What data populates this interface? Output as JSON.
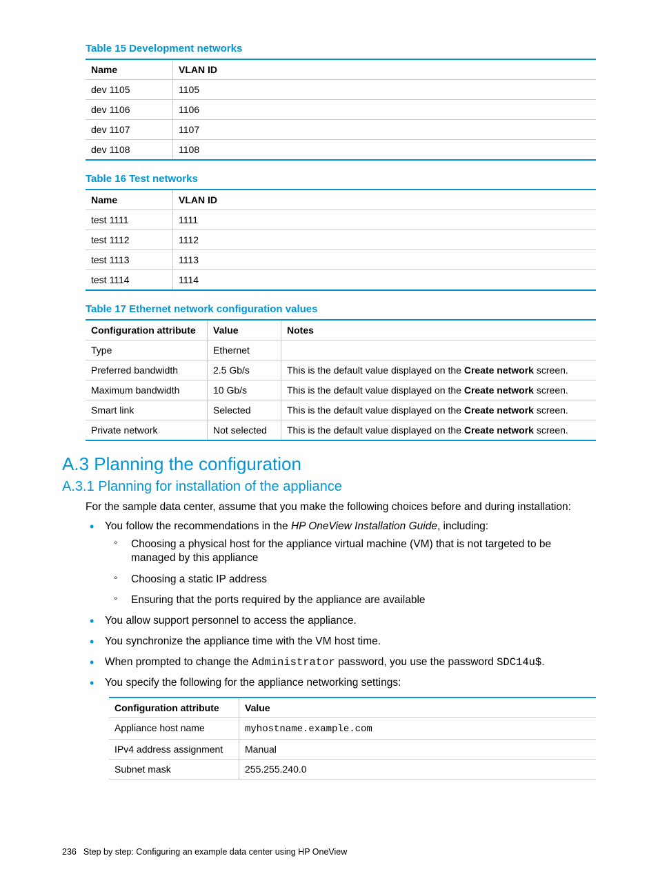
{
  "tables": {
    "t15": {
      "caption": "Table 15 Development networks",
      "headers": [
        "Name",
        "VLAN ID"
      ],
      "rows": [
        [
          "dev 1105",
          "1105"
        ],
        [
          "dev 1106",
          "1106"
        ],
        [
          "dev 1107",
          "1107"
        ],
        [
          "dev 1108",
          "1108"
        ]
      ]
    },
    "t16": {
      "caption": "Table 16 Test networks",
      "headers": [
        "Name",
        "VLAN ID"
      ],
      "rows": [
        [
          "test 1111",
          "1111"
        ],
        [
          "test 1112",
          "1112"
        ],
        [
          "test 1113",
          "1113"
        ],
        [
          "test 1114",
          "1114"
        ]
      ]
    },
    "t17": {
      "caption": "Table 17 Ethernet network configuration values",
      "headers": [
        "Configuration attribute",
        "Value",
        "Notes"
      ],
      "rows": [
        {
          "attr": "Type",
          "value": "Ethernet",
          "note_pre": "",
          "note_bold": "",
          "note_post": ""
        },
        {
          "attr": "Preferred bandwidth",
          "value": "2.5 Gb/s",
          "note_pre": "This is the default value displayed on the ",
          "note_bold": "Create network",
          "note_post": " screen."
        },
        {
          "attr": "Maximum bandwidth",
          "value": "10 Gb/s",
          "note_pre": "This is the default value displayed on the ",
          "note_bold": "Create network",
          "note_post": " screen."
        },
        {
          "attr": "Smart link",
          "value": "Selected",
          "note_pre": "This is the default value displayed on the ",
          "note_bold": "Create network",
          "note_post": " screen."
        },
        {
          "attr": "Private network",
          "value": "Not selected",
          "note_pre": "This is the default value displayed on the ",
          "note_bold": "Create network",
          "note_post": " screen."
        }
      ]
    },
    "settings": {
      "headers": [
        "Configuration attribute",
        "Value"
      ],
      "rows": [
        {
          "attr": "Appliance host name",
          "value": "myhostname.example.com",
          "mono": true
        },
        {
          "attr": "IPv4 address assignment",
          "value": "Manual",
          "mono": false
        },
        {
          "attr": "Subnet mask",
          "value": "255.255.240.0",
          "mono": false
        }
      ]
    }
  },
  "headings": {
    "a3": "A.3 Planning the configuration",
    "a31": "A.3.1 Planning for installation of the appliance"
  },
  "paras": {
    "intro": "For the sample data center, assume that you make the following choices before and during installation:",
    "b1_pre": "You follow the recommendations in the ",
    "b1_em": "HP OneView Installation Guide",
    "b1_post": ", including:",
    "s1": "Choosing a physical host for the appliance virtual machine (VM) that is not targeted to be managed by this appliance",
    "s2": "Choosing a static IP address",
    "s3": "Ensuring that the ports required by the appliance are available",
    "b2": "You allow support personnel to access the appliance.",
    "b3": "You synchronize the appliance time with the VM host time.",
    "b4_pre": "When prompted to change the ",
    "b4_mono1": "Administrator",
    "b4_mid": " password, you use the password ",
    "b4_mono2": "SDC14u$",
    "b4_post": ".",
    "b5": "You specify the following for the appliance networking settings:"
  },
  "footer": {
    "pagenum": "236",
    "title": "Step by step: Configuring an example data center using HP OneView"
  }
}
